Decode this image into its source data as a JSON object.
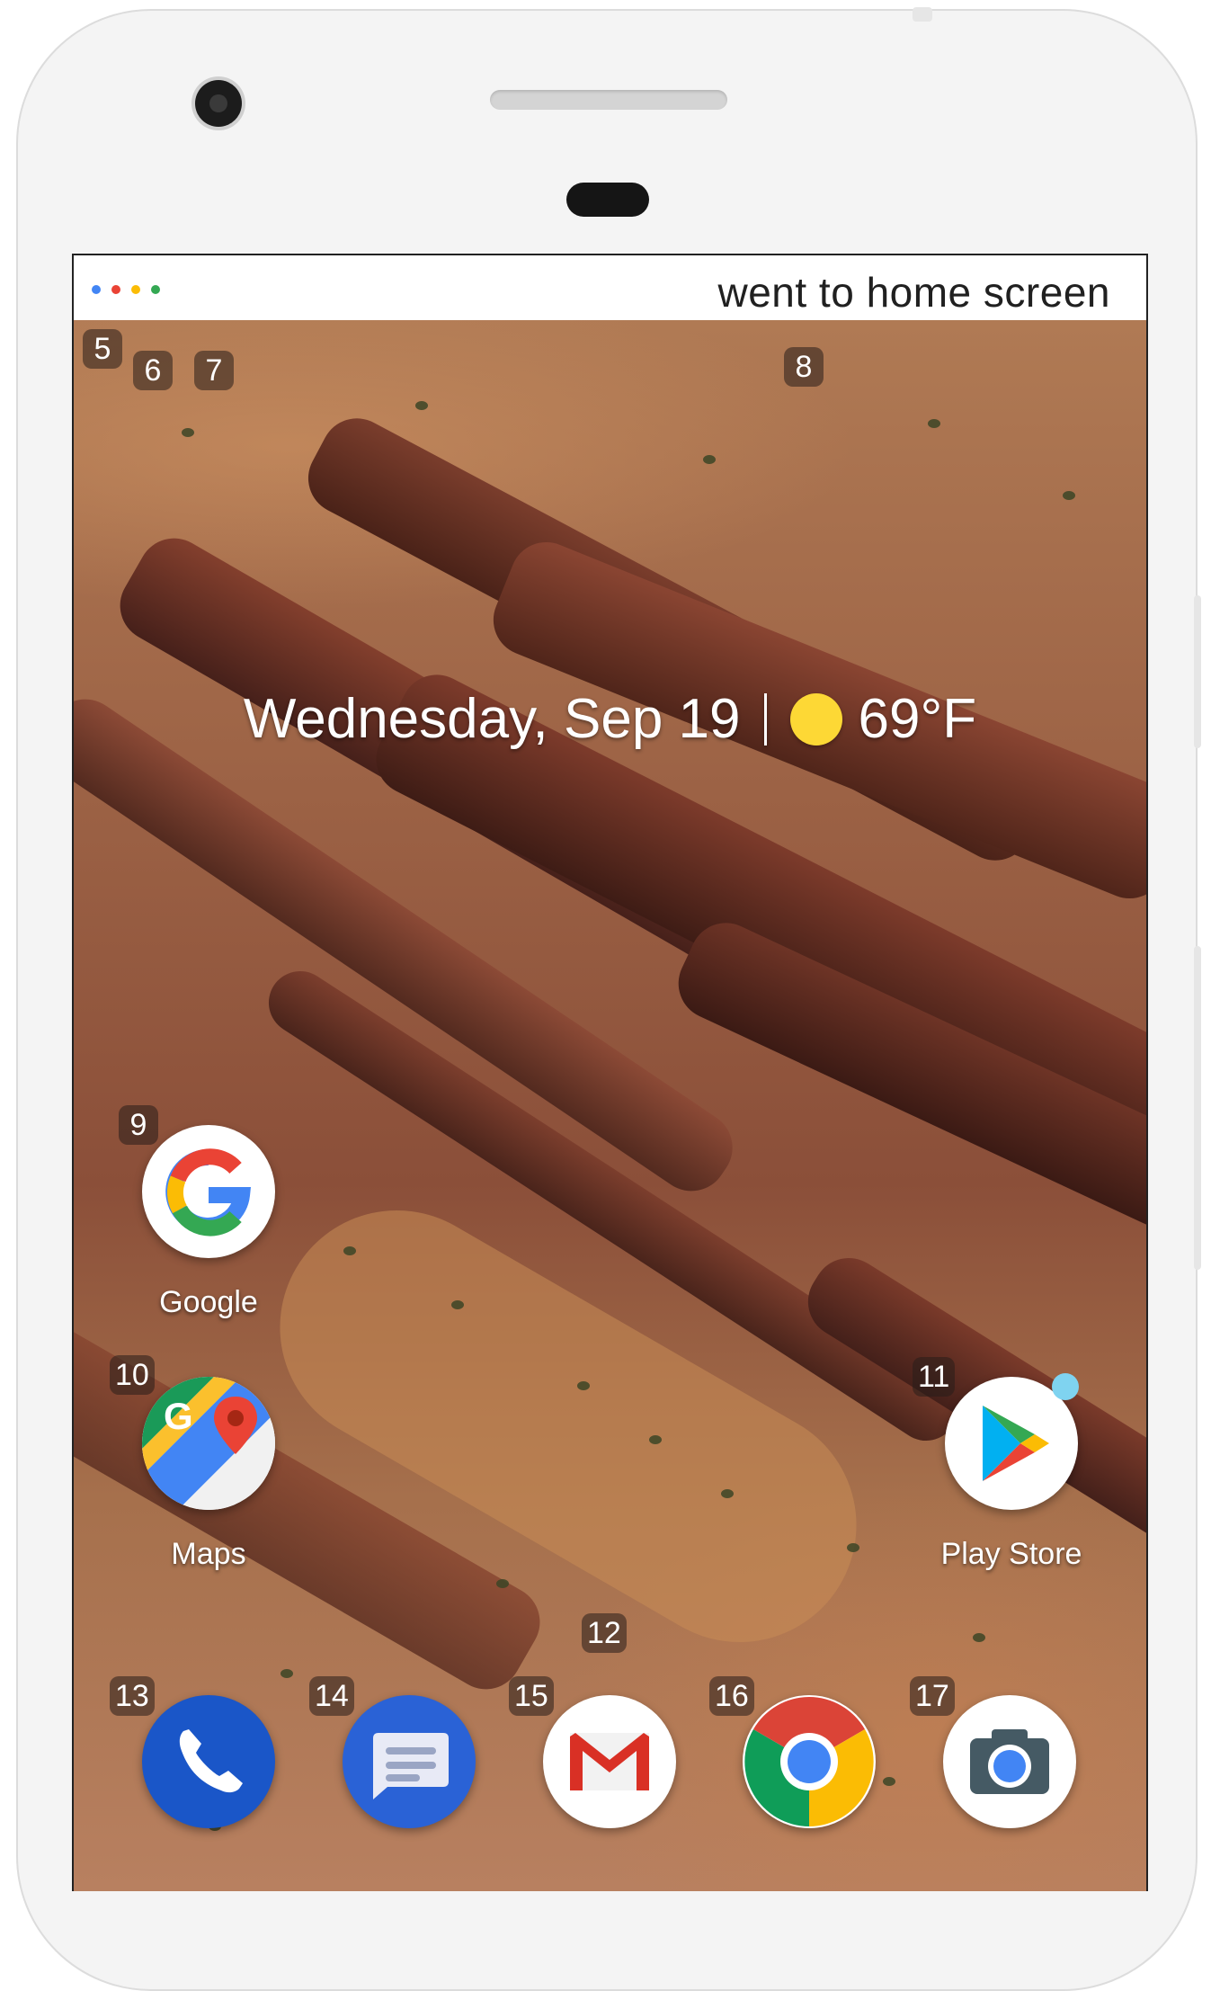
{
  "status_bar": {
    "message": "went to home screen",
    "dot_colors": [
      "#4285F4",
      "#EA4335",
      "#FBBC05",
      "#34A853"
    ]
  },
  "overlay_labels": [
    "5",
    "6",
    "7",
    "8",
    "9",
    "10",
    "11",
    "12",
    "13",
    "14",
    "15",
    "16",
    "17"
  ],
  "at_a_glance": {
    "date": "Wednesday, Sep 19",
    "temperature": "69°F",
    "weather_icon": "sun-icon"
  },
  "apps": {
    "google": {
      "label": "Google",
      "icon": "google-g-icon"
    },
    "maps": {
      "label": "Maps",
      "icon": "maps-icon"
    },
    "play_store": {
      "label": "Play Store",
      "icon": "play-store-icon"
    }
  },
  "dock": [
    {
      "name": "phone",
      "icon": "phone-icon",
      "color": "#1a56c8"
    },
    {
      "name": "messages",
      "icon": "messages-icon",
      "color": "#2a62d6"
    },
    {
      "name": "gmail",
      "icon": "gmail-icon",
      "color": "#ffffff"
    },
    {
      "name": "chrome",
      "icon": "chrome-icon",
      "color": "#ffffff"
    },
    {
      "name": "camera",
      "icon": "camera-icon",
      "color": "#ffffff"
    }
  ]
}
